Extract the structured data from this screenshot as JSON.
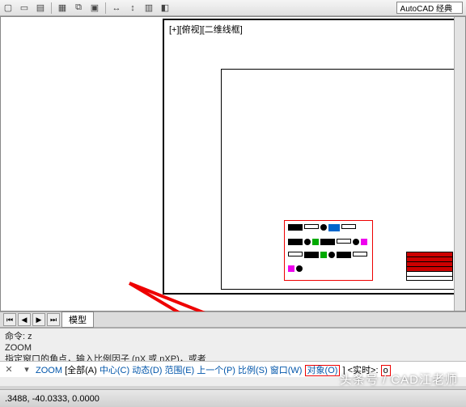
{
  "workspace_selector": "AutoCAD 经典",
  "viewport_label": "[+][俯视][二维线框]",
  "model_tab": "模型",
  "cmd_history": {
    "line1": "命令: z",
    "line2": "ZOOM",
    "line3": "指定窗口的角点，输入比例因子 (nX 或 nXP)，或者"
  },
  "cmd_prompt": {
    "zoom": "ZOOM",
    "all": "[全部(A)",
    "center": "中心(C)",
    "dynamic": "动态(D)",
    "extents": "范围(E)",
    "previous": "上一个(P)",
    "scale": "比例(S)",
    "window": "窗口(W)",
    "object": "对象(O)",
    "realtime": "] <实时>: ",
    "caret": "o"
  },
  "status_coords": ".3488, -40.0333, 0.0000",
  "watermark": "头条号 / CAD江老师"
}
